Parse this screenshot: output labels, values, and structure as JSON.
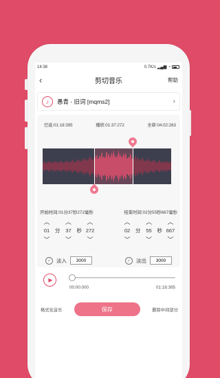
{
  "status": {
    "time": "14:38",
    "network_speed": "0.7K/s"
  },
  "header": {
    "title": "剪切音乐",
    "help_label": "帮助",
    "back_icon": "chevron-left-icon"
  },
  "song": {
    "name": "愚青 - 旧词 [mqms2]"
  },
  "times": {
    "selected": "已选:01:18:395",
    "playing": "播放:01:37:272",
    "total": "全部:04:02:263"
  },
  "waveform": {
    "selection_start_fraction": 0.4,
    "selection_end_fraction": 0.7
  },
  "start": {
    "label": "开始时间:01分37秒272毫秒",
    "min": "01",
    "sec": "37",
    "ms": "272",
    "unit_min": "分",
    "unit_sec": "秒"
  },
  "end": {
    "label": "结束时间:02分55秒667毫秒",
    "min": "02",
    "sec": "55",
    "ms": "667",
    "unit_min": "分",
    "unit_sec": "秒"
  },
  "fade_in": {
    "label": "淡入",
    "value": "3000"
  },
  "fade_out": {
    "label": "淡出",
    "value": "3000"
  },
  "player": {
    "current": "00:00:000",
    "duration": "01:18:395",
    "progress_fraction": 0.0
  },
  "actions": {
    "format_label": "格式化音乐",
    "save_label": "保存",
    "delete_middle_label": "删除中间部分"
  },
  "colors": {
    "brand": "#e04b67",
    "save_button": "#ee7389",
    "waveform_bg": "#3d3f4e"
  }
}
